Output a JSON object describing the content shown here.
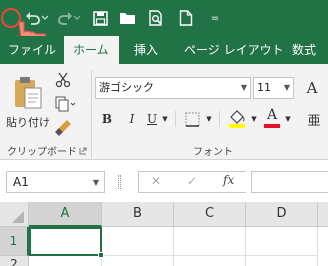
{
  "quick_access": {
    "customize_glyph": "="
  },
  "tabs": [
    {
      "label": "ファイル"
    },
    {
      "label": "ホーム"
    },
    {
      "label": "挿入"
    },
    {
      "label": "ページ レイアウト"
    },
    {
      "label": "数式"
    }
  ],
  "clipboard": {
    "paste_label": "貼り付け",
    "group_label": "クリップボード"
  },
  "font": {
    "name": "游ゴシック",
    "size": "11",
    "bold": "B",
    "italic": "I",
    "underline": "U",
    "font_color_glyph": "A",
    "group_label": "フォント"
  },
  "formula_bar": {
    "name_box": "A1",
    "cancel_glyph": "✕",
    "enter_glyph": "✓",
    "fx_label": "fx",
    "formula": ""
  },
  "grid": {
    "columns": [
      "A",
      "B",
      "C",
      "D"
    ],
    "rows": [
      "1",
      "2"
    ]
  },
  "colors": {
    "accent": "#217346",
    "highlight_marker": "#e8473f",
    "fill_color": "#ffff00",
    "font_color": "#e81123"
  }
}
